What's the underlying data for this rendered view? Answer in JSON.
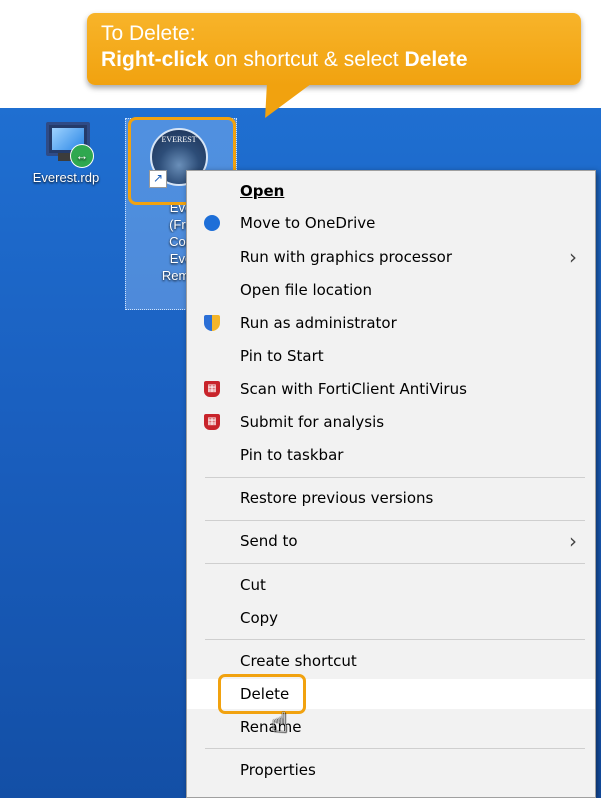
{
  "callout": {
    "line1": "To Delete:",
    "bold1": "Right-click",
    "mid": " on shortcut & select ",
    "bold2": "Delete",
    "color": "#f1a20f"
  },
  "desktop": {
    "icons": [
      {
        "label": "Everest.rdp",
        "icon": "remote-desktop-icon"
      },
      {
        "lines": [
          "Eve",
          "(Fre",
          "Cou",
          "Eve",
          "Remot"
        ],
        "icon": "everest-logo-icon"
      }
    ],
    "logo_text": "EVEREST"
  },
  "menu": {
    "items": [
      {
        "label": "Open",
        "bold": true
      },
      {
        "label": "Move to OneDrive",
        "icon": "onedrive-icon"
      },
      {
        "label": "Run with graphics processor",
        "submenu": true
      },
      {
        "label": "Open file location"
      },
      {
        "label": "Run as administrator",
        "icon": "uac-shield-icon"
      },
      {
        "label": "Pin to Start"
      },
      {
        "label": "Scan with FortiClient AntiVirus",
        "icon": "forticlient-icon"
      },
      {
        "label": "Submit for analysis",
        "icon": "forticlient-icon"
      },
      {
        "label": "Pin to taskbar"
      },
      {
        "label": "Restore previous versions"
      },
      {
        "label": "Send to",
        "submenu": true
      },
      {
        "label": "Cut"
      },
      {
        "label": "Copy"
      },
      {
        "label": "Create shortcut"
      },
      {
        "label": "Delete",
        "highlighted": true
      },
      {
        "label": "Rename"
      },
      {
        "label": "Properties"
      }
    ]
  }
}
